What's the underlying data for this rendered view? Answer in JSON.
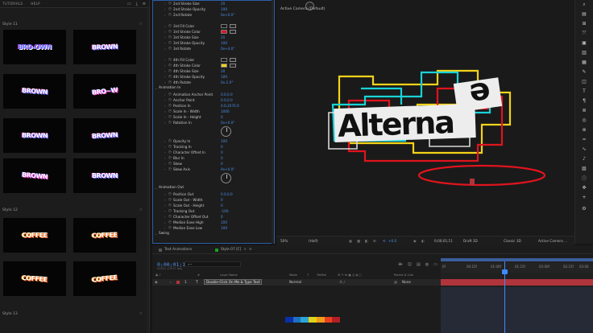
{
  "left_panel": {
    "tabs": [
      "TUTORIALS",
      "HELP"
    ],
    "sections": [
      {
        "title": "Style 11",
        "thumbs": [
          {
            "text": "BRO-OWN",
            "colors": [
              "#5a6cff",
              "#ffffff",
              "#ff3fd0"
            ]
          },
          {
            "text": "BROWN",
            "colors": [
              "#ffffff",
              "#5a6cff",
              "#ff3fd0"
            ]
          },
          {
            "text": "BROWN",
            "colors": [
              "#ffffff",
              "#5a6cff",
              "#ff3fd0"
            ]
          },
          {
            "text": "BRO~W",
            "colors": [
              "#ffffff",
              "#ff3fd0",
              "#5a6cff"
            ]
          },
          {
            "text": "BROWN",
            "colors": [
              "#ffffff",
              "#5a6cff",
              "#ff3fd0"
            ]
          },
          {
            "text": "BROWN",
            "colors": [
              "#ffffff",
              "#5a6cff",
              "#ff3fd0"
            ]
          },
          {
            "text": "BROWN",
            "colors": [
              "#ffffff",
              "#ff3fd0",
              "#5a6cff"
            ]
          },
          {
            "text": "BROWN",
            "colors": [
              "#ffffff",
              "#5a6cff",
              "#ff3fd0"
            ]
          }
        ]
      },
      {
        "title": "Style 12",
        "thumbs": [
          {
            "text": "COFFEE",
            "colors": [
              "#ffffff",
              "#ff5a1f",
              "#ffc21a"
            ]
          },
          {
            "text": "COFFEE",
            "colors": [
              "#ffffff",
              "#ff5a1f",
              "#ffc21a"
            ]
          },
          {
            "text": "COFFEE",
            "colors": [
              "#ffffff",
              "#ff5a1f",
              "#ffc21a"
            ]
          },
          {
            "text": "COFFEE",
            "colors": [
              "#ffffff",
              "#ff5a1f",
              "#ffc21a"
            ]
          }
        ]
      },
      {
        "title": "Style 13",
        "thumbs": []
      }
    ]
  },
  "effect_controls": {
    "rows": [
      {
        "label": "2nd Stroke Size",
        "value": "20"
      },
      {
        "label": "2nd Stroke Opacity",
        "value": "100"
      },
      {
        "label": "2nd Rotate",
        "value": "0x+0.0°"
      },
      {
        "label": "3rd Fill Color",
        "color": "#1b1b1b"
      },
      {
        "label": "3rd Stroke Color",
        "color": "#e0141e"
      },
      {
        "label": "3rd Stroke Size",
        "value": "20"
      },
      {
        "label": "3rd Stroke Opacity",
        "value": "100"
      },
      {
        "label": "3rd Rotate",
        "value": "0x+4.0°"
      },
      {
        "label": "4th Fill Color",
        "color": "#1b1b1b"
      },
      {
        "label": "4th Stroke Color",
        "color": "#f2d31a"
      },
      {
        "label": "4th Stroke Size",
        "value": "20"
      },
      {
        "label": "4th Stroke Opacity",
        "value": "100"
      },
      {
        "label": "4th Rotate",
        "value": "0x-2.0°"
      },
      {
        "label": "Animation In",
        "group": true
      },
      {
        "label": "Animation Anchor Point",
        "value": "0.0,0.0"
      },
      {
        "label": "Anchor Point",
        "value": "0.0,0.0"
      },
      {
        "label": "Position In",
        "value": "0.0,2070.0"
      },
      {
        "label": "Scale In - Width",
        "value": "1000"
      },
      {
        "label": "Scale In - Height",
        "value": "0"
      },
      {
        "label": "Rotation In",
        "value": "0x+0.0°"
      },
      {
        "label": "Opacity In",
        "value": "100"
      },
      {
        "label": "Tracking In",
        "value": "0"
      },
      {
        "label": "Character Offset In",
        "value": "0"
      },
      {
        "label": "Blur In",
        "value": "0"
      },
      {
        "label": "Skew",
        "value": "0"
      },
      {
        "label": "Skew Axis",
        "value": "0x+0.0°"
      },
      {
        "label": "Animation Out",
        "group": true
      },
      {
        "label": "Position Out",
        "value": "0.0,0.0"
      },
      {
        "label": "Scale Out - Width",
        "value": "0"
      },
      {
        "label": "Scale Out - Height",
        "value": "0"
      },
      {
        "label": "Tracking Out",
        "value": "-100"
      },
      {
        "label": "Character Offset Out",
        "value": "0"
      },
      {
        "label": "Median Ease High",
        "value": "100"
      },
      {
        "label": "Median Ease Low",
        "value": "100"
      },
      {
        "label": "Swing",
        "group": true
      }
    ]
  },
  "viewer": {
    "label": "Active Camera (Default)",
    "art_text": "Alterna",
    "art_badge": "e",
    "bottom_bar": {
      "zoom": "50%",
      "resolution": "(Half)",
      "exposure": "+0.0",
      "timecode": "0;00;01;11",
      "draft": "Draft 3D",
      "renderer": "Classic 3D",
      "camera": "Active Camera ..."
    }
  },
  "timeline": {
    "tabs": [
      {
        "label": "Text Animations",
        "color": "#3a3a3a"
      },
      {
        "label": "Style 07 [C]",
        "color": "#19a11f"
      }
    ],
    "time": "0;00;01;11",
    "frames": "00041 (29.97 fps)",
    "search_placeholder": "⌕~",
    "headers": [
      "Layer Name",
      "Mode",
      "T",
      "TrkMat",
      "Parent & Link"
    ],
    "layer": {
      "index": "1",
      "name": "Double-Click On Me & Type Text",
      "mode": "Normal",
      "parent": "None"
    },
    "ruler": [
      "0f",
      "00:15f",
      "01:00f",
      "01:15f",
      "02:00f",
      "02:15f",
      "03:00"
    ]
  },
  "swatch_colors": [
    "#0a2fa8",
    "#1f6fc4",
    "#2aa6d6",
    "#e0d21a",
    "#f29a1a",
    "#e8401e",
    "#b51e24"
  ]
}
